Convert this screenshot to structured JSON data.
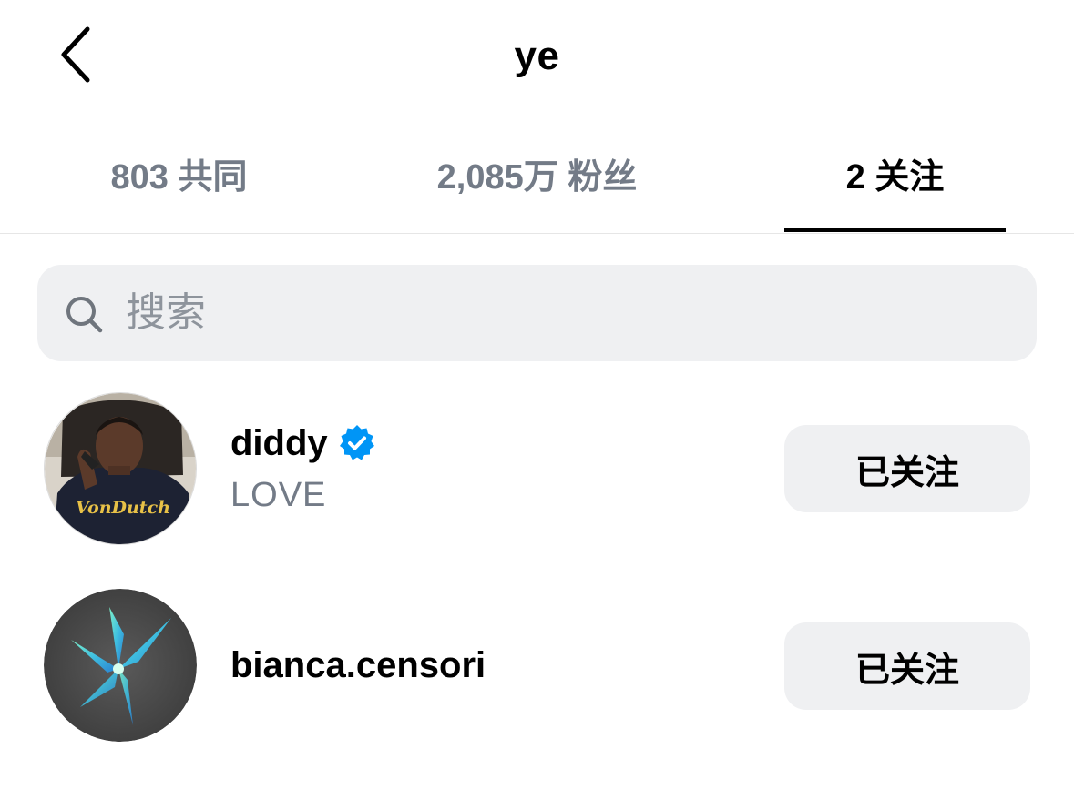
{
  "header": {
    "title": "ye",
    "back_icon": "chevron-left-icon"
  },
  "tabs": [
    {
      "label": "803 共同",
      "active": false
    },
    {
      "label": "2,085万 粉丝",
      "active": false
    },
    {
      "label": "2 关注",
      "active": true
    }
  ],
  "search": {
    "placeholder": "搜索",
    "value": "",
    "icon": "search-icon"
  },
  "following": [
    {
      "username": "diddy",
      "verified": true,
      "subtitle": "LOVE",
      "button_label": "已关注"
    },
    {
      "username": "bianca.censori",
      "verified": false,
      "subtitle": "",
      "button_label": "已关注"
    }
  ],
  "colors": {
    "verified_blue": "#0095f6",
    "secondary_text": "#737b87",
    "button_bg": "#eff0f2"
  }
}
